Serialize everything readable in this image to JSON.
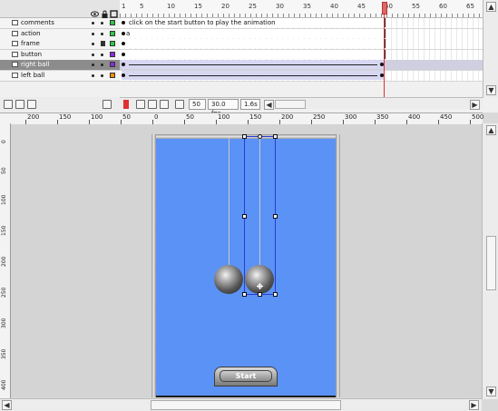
{
  "timeline": {
    "frame_numbers": [
      "1",
      "5",
      "10",
      "15",
      "20",
      "25",
      "30",
      "35",
      "40",
      "45",
      "50",
      "55",
      "60",
      "65"
    ],
    "layers": [
      {
        "name": "comments",
        "selected": false,
        "color": "#2ec845"
      },
      {
        "name": "action",
        "selected": false,
        "color": "#2ec845"
      },
      {
        "name": "frame",
        "selected": false,
        "color": "#2ec845"
      },
      {
        "name": "button",
        "selected": false,
        "color": "#8a2be2"
      },
      {
        "name": "right ball",
        "selected": true,
        "color": "#8a2be2"
      },
      {
        "name": "left ball",
        "selected": false,
        "color": "#ff8c00"
      }
    ],
    "comment_text": "click on the start button to play the animation",
    "action_marker": "a",
    "current_frame": "50",
    "frame_rate": "30.0 fps",
    "elapsed_time": "1.6s"
  },
  "ruler": {
    "h_labels": [
      "200",
      "150",
      "100",
      "50",
      "0",
      "50",
      "100",
      "150",
      "200",
      "250",
      "300",
      "350",
      "400",
      "450",
      "500"
    ],
    "v_labels": [
      "0",
      "50",
      "100",
      "150",
      "200",
      "250",
      "300",
      "350",
      "400"
    ]
  },
  "stage": {
    "button_label": "Start",
    "colors": {
      "stage_bg": "#5b92f5",
      "selection": "#2a3bd6",
      "playhead": "#e03030"
    }
  }
}
